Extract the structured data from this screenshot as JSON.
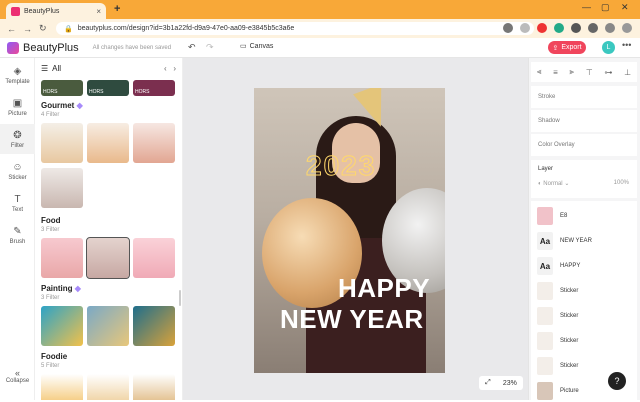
{
  "browser": {
    "tab_title": "BeautyPlus",
    "url": "beautyplus.com/design?id=3b1a22fd-d9a9-47e0-aa09-e3845b5c3a6e"
  },
  "header": {
    "brand": "BeautyPlus",
    "saved_status": "All changes have been saved",
    "canvas_label": "Canvas",
    "export_label": "Export",
    "avatar_letter": "L",
    "more": "•••"
  },
  "toolbar": [
    {
      "label": "Template",
      "icon": "layers-icon"
    },
    {
      "label": "Picture",
      "icon": "picture-icon"
    },
    {
      "label": "Filter",
      "icon": "filter-icon"
    },
    {
      "label": "Sticker",
      "icon": "sticker-icon"
    },
    {
      "label": "Text",
      "icon": "text-icon"
    },
    {
      "label": "Brush",
      "icon": "brush-icon"
    }
  ],
  "collapse_label": "Collapse",
  "panel": {
    "title": "All",
    "top_thumbs": [
      "HORS",
      "HORS",
      "HORS"
    ],
    "categories": [
      {
        "name": "Gourmet",
        "count": "4 Filter"
      },
      {
        "name": "Food",
        "count": "3 Filter"
      },
      {
        "name": "Painting",
        "count": "3 Filter"
      },
      {
        "name": "Foodie",
        "count": "5 Filter"
      }
    ]
  },
  "poster": {
    "year": "2023",
    "line1": "HAPPY",
    "line2": "NEW YEAR"
  },
  "zoom": "23%",
  "right_panel": {
    "props": [
      "Stroke",
      "Shadow",
      "Color Overlay"
    ],
    "layer_title": "Layer",
    "blend": "Normal",
    "opacity": "100%",
    "layers": [
      {
        "label": "E8",
        "thumb": ""
      },
      {
        "label": "NEW YEAR",
        "thumb": "Aa"
      },
      {
        "label": "HAPPY",
        "thumb": "Aa"
      },
      {
        "label": "Sticker",
        "thumb": ""
      },
      {
        "label": "Sticker",
        "thumb": ""
      },
      {
        "label": "Sticker",
        "thumb": ""
      },
      {
        "label": "Sticker",
        "thumb": ""
      },
      {
        "label": "Picture",
        "thumb": ""
      }
    ]
  },
  "help": "?"
}
